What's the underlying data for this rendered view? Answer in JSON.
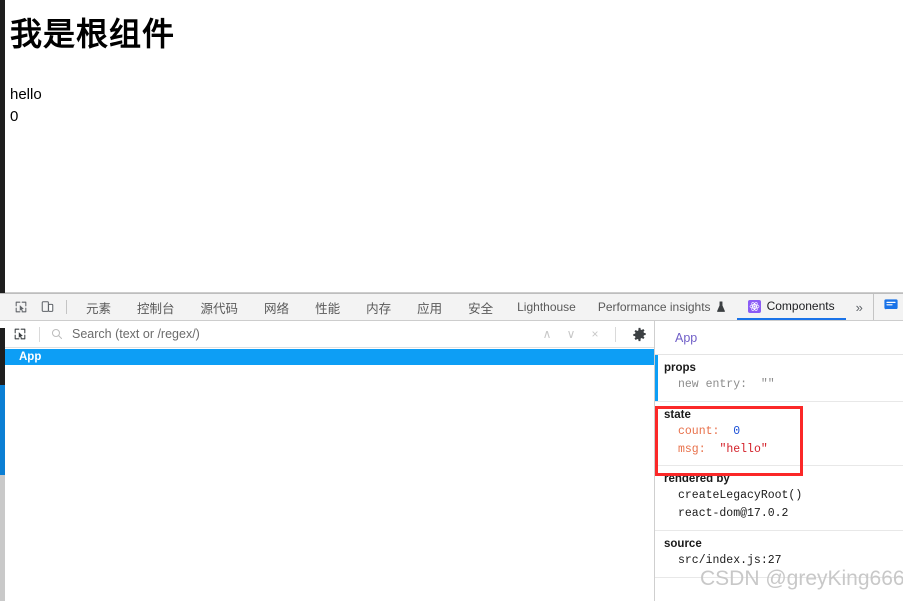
{
  "page": {
    "title": "我是根组件",
    "lines": [
      "hello",
      "0"
    ]
  },
  "devtools": {
    "left_icons": [
      {
        "name": "inspect-element-icon",
        "glyph": "inspect"
      },
      {
        "name": "device-toolbar-icon",
        "glyph": "device"
      }
    ],
    "tabs": [
      {
        "label": "元素",
        "selected": false,
        "cjk": true
      },
      {
        "label": "控制台",
        "selected": false,
        "cjk": true
      },
      {
        "label": "源代码",
        "selected": false,
        "cjk": true
      },
      {
        "label": "网络",
        "selected": false,
        "cjk": true
      },
      {
        "label": "性能",
        "selected": false,
        "cjk": true
      },
      {
        "label": "内存",
        "selected": false,
        "cjk": true
      },
      {
        "label": "应用",
        "selected": false,
        "cjk": true
      },
      {
        "label": "安全",
        "selected": false,
        "cjk": true
      },
      {
        "label": "Lighthouse",
        "selected": false,
        "cjk": false
      },
      {
        "label": "Performance insights",
        "selected": false,
        "cjk": false,
        "badge": "flask-icon"
      },
      {
        "label": "Components",
        "selected": true,
        "cjk": false,
        "icon": "react-logo-icon"
      }
    ],
    "more_tabs_label": "»",
    "feedback_icon": "feedback-icon",
    "accent_color": "#1a73e8"
  },
  "components_panel": {
    "toolbar": {
      "select_element_icon": "select-element-icon",
      "search_placeholder": "Search (text or /regex/)",
      "search_value": "",
      "prev_match_label": "∧",
      "next_match_label": "∨",
      "clear_label": "×",
      "settings_icon": "gear-icon"
    },
    "tree": [
      {
        "label": "App",
        "selected": true,
        "depth": 0
      }
    ],
    "selected_highlight_color": "#0d9ef5"
  },
  "inspector": {
    "component_name": "App",
    "sections": [
      {
        "title": "props",
        "has_accent_bar": true,
        "rows": [
          {
            "key": "new entry",
            "key_style": "gray",
            "value": "\"\"",
            "value_style": "gray"
          }
        ]
      },
      {
        "title": "state",
        "has_accent_bar": false,
        "highlighted": true,
        "rows": [
          {
            "key": "count",
            "key_style": "orange",
            "value": "0",
            "value_style": "num"
          },
          {
            "key": "msg",
            "key_style": "orange",
            "value": "\"hello\"",
            "value_style": "str"
          }
        ]
      },
      {
        "title": "rendered by",
        "has_accent_bar": false,
        "plain_rows": [
          "createLegacyRoot()",
          "react-dom@17.0.2"
        ]
      },
      {
        "title": "source",
        "has_accent_bar": false,
        "plain_rows": [
          "src/index.js:27"
        ]
      }
    ],
    "highlight_color": "#fb2828"
  },
  "watermark": "CSDN @greyKing666"
}
